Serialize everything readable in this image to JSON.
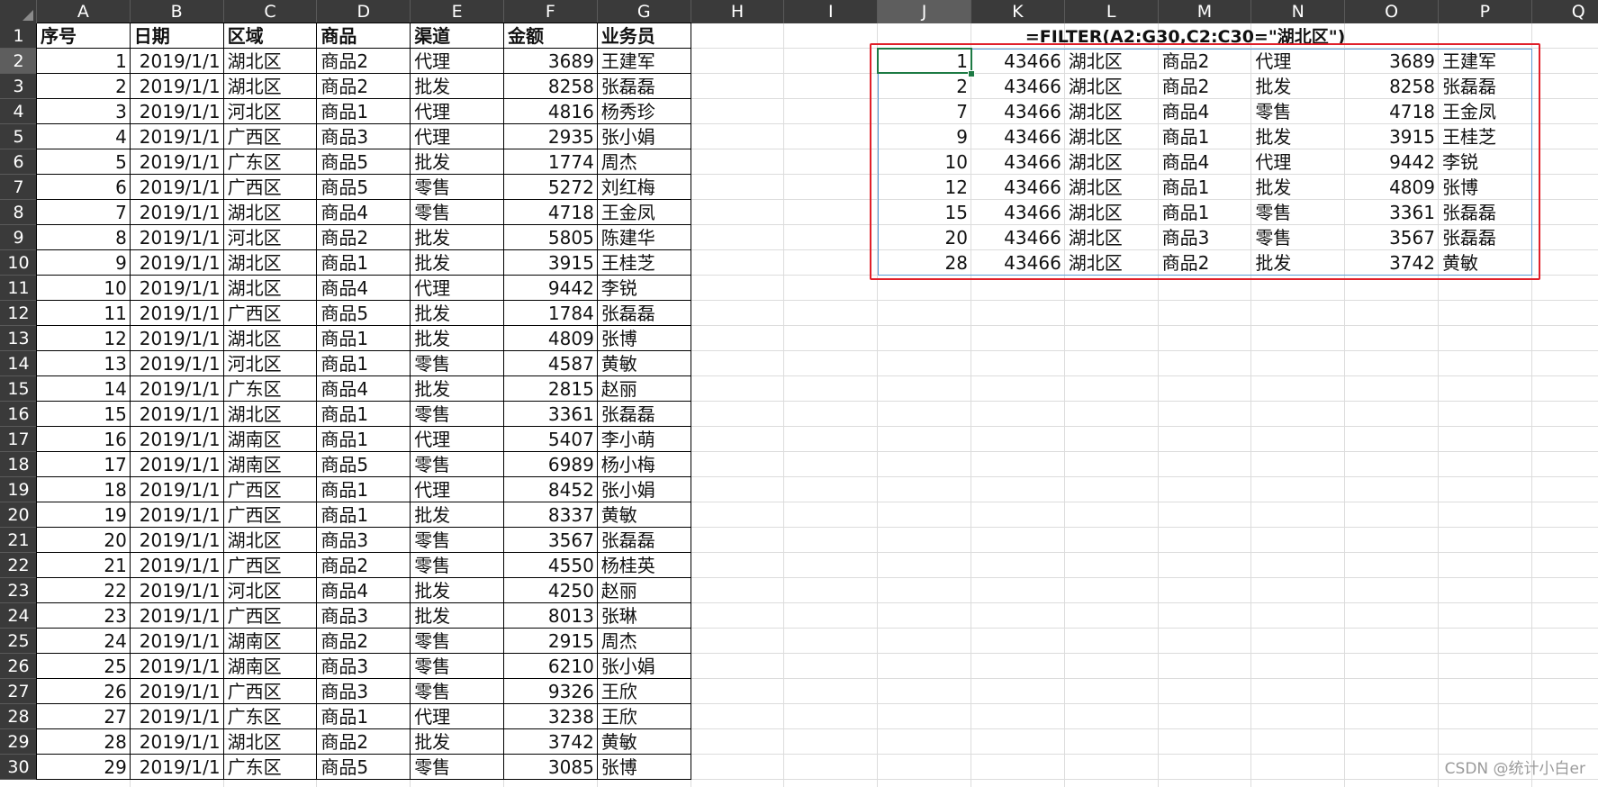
{
  "columns": [
    "A",
    "B",
    "C",
    "D",
    "E",
    "F",
    "G",
    "H",
    "I",
    "J",
    "K",
    "L",
    "M",
    "N",
    "O",
    "P",
    "Q"
  ],
  "selected_column": "J",
  "rows": [
    "1",
    "2",
    "3",
    "4",
    "5",
    "6",
    "7",
    "8",
    "9",
    "10",
    "11",
    "12",
    "13",
    "14",
    "15",
    "16",
    "17",
    "18",
    "19",
    "20",
    "21",
    "22",
    "23",
    "24",
    "25",
    "26",
    "27",
    "28",
    "29",
    "30"
  ],
  "selected_row": "2",
  "source_table": {
    "headers": [
      "序号",
      "日期",
      "区域",
      "商品",
      "渠道",
      "金额",
      "业务员"
    ],
    "rows": [
      [
        "1",
        "2019/1/1",
        "湖北区",
        "商品2",
        "代理",
        "3689",
        "王建军"
      ],
      [
        "2",
        "2019/1/1",
        "湖北区",
        "商品2",
        "批发",
        "8258",
        "张磊磊"
      ],
      [
        "3",
        "2019/1/1",
        "河北区",
        "商品1",
        "代理",
        "4816",
        "杨秀珍"
      ],
      [
        "4",
        "2019/1/1",
        "广西区",
        "商品3",
        "代理",
        "2935",
        "张小娟"
      ],
      [
        "5",
        "2019/1/1",
        "广东区",
        "商品5",
        "批发",
        "1774",
        "周杰"
      ],
      [
        "6",
        "2019/1/1",
        "广西区",
        "商品5",
        "零售",
        "5272",
        "刘红梅"
      ],
      [
        "7",
        "2019/1/1",
        "湖北区",
        "商品4",
        "零售",
        "4718",
        "王金凤"
      ],
      [
        "8",
        "2019/1/1",
        "河北区",
        "商品2",
        "批发",
        "5805",
        "陈建华"
      ],
      [
        "9",
        "2019/1/1",
        "湖北区",
        "商品1",
        "批发",
        "3915",
        "王桂芝"
      ],
      [
        "10",
        "2019/1/1",
        "湖北区",
        "商品4",
        "代理",
        "9442",
        "李锐"
      ],
      [
        "11",
        "2019/1/1",
        "广西区",
        "商品5",
        "批发",
        "1784",
        "张磊磊"
      ],
      [
        "12",
        "2019/1/1",
        "湖北区",
        "商品1",
        "批发",
        "4809",
        "张博"
      ],
      [
        "13",
        "2019/1/1",
        "河北区",
        "商品1",
        "零售",
        "4587",
        "黄敏"
      ],
      [
        "14",
        "2019/1/1",
        "广东区",
        "商品4",
        "批发",
        "2815",
        "赵丽"
      ],
      [
        "15",
        "2019/1/1",
        "湖北区",
        "商品1",
        "零售",
        "3361",
        "张磊磊"
      ],
      [
        "16",
        "2019/1/1",
        "湖南区",
        "商品1",
        "代理",
        "5407",
        "李小萌"
      ],
      [
        "17",
        "2019/1/1",
        "湖南区",
        "商品5",
        "零售",
        "6989",
        "杨小梅"
      ],
      [
        "18",
        "2019/1/1",
        "广西区",
        "商品1",
        "代理",
        "8452",
        "张小娟"
      ],
      [
        "19",
        "2019/1/1",
        "广西区",
        "商品1",
        "批发",
        "8337",
        "黄敏"
      ],
      [
        "20",
        "2019/1/1",
        "湖北区",
        "商品3",
        "零售",
        "3567",
        "张磊磊"
      ],
      [
        "21",
        "2019/1/1",
        "广西区",
        "商品2",
        "零售",
        "4550",
        "杨桂英"
      ],
      [
        "22",
        "2019/1/1",
        "河北区",
        "商品4",
        "批发",
        "4250",
        "赵丽"
      ],
      [
        "23",
        "2019/1/1",
        "广西区",
        "商品3",
        "批发",
        "8013",
        "张琳"
      ],
      [
        "24",
        "2019/1/1",
        "湖南区",
        "商品2",
        "零售",
        "2915",
        "周杰"
      ],
      [
        "25",
        "2019/1/1",
        "湖南区",
        "商品3",
        "零售",
        "6210",
        "张小娟"
      ],
      [
        "26",
        "2019/1/1",
        "广西区",
        "商品3",
        "零售",
        "9326",
        "王欣"
      ],
      [
        "27",
        "2019/1/1",
        "广东区",
        "商品1",
        "代理",
        "3238",
        "王欣"
      ],
      [
        "28",
        "2019/1/1",
        "湖北区",
        "商品2",
        "批发",
        "3742",
        "黄敏"
      ],
      [
        "29",
        "2019/1/1",
        "广东区",
        "商品5",
        "零售",
        "3085",
        "张博"
      ]
    ]
  },
  "formula_label": "=FILTER(A2:G30,C2:C30=\"湖北区\")",
  "filter_result": [
    [
      "1",
      "43466",
      "湖北区",
      "商品2",
      "代理",
      "3689",
      "王建军"
    ],
    [
      "2",
      "43466",
      "湖北区",
      "商品2",
      "批发",
      "8258",
      "张磊磊"
    ],
    [
      "7",
      "43466",
      "湖北区",
      "商品4",
      "零售",
      "4718",
      "王金凤"
    ],
    [
      "9",
      "43466",
      "湖北区",
      "商品1",
      "批发",
      "3915",
      "王桂芝"
    ],
    [
      "10",
      "43466",
      "湖北区",
      "商品4",
      "代理",
      "9442",
      "李锐"
    ],
    [
      "12",
      "43466",
      "湖北区",
      "商品1",
      "批发",
      "4809",
      "张博"
    ],
    [
      "15",
      "43466",
      "湖北区",
      "商品1",
      "零售",
      "3361",
      "张磊磊"
    ],
    [
      "20",
      "43466",
      "湖北区",
      "商品3",
      "零售",
      "3567",
      "张磊磊"
    ],
    [
      "28",
      "43466",
      "湖北区",
      "商品2",
      "批发",
      "3742",
      "黄敏"
    ]
  ],
  "watermark": "CSDN @统计小白er",
  "colors": {
    "header_bg": "#3a3a3a",
    "header_selected_bg": "#5e5e5e",
    "header_text": "#ffffff",
    "gridline": "#dcdcdc",
    "highlight_box": "#e0202a",
    "spill_border": "#5b9bd5",
    "active_cell": "#1d7a44"
  }
}
